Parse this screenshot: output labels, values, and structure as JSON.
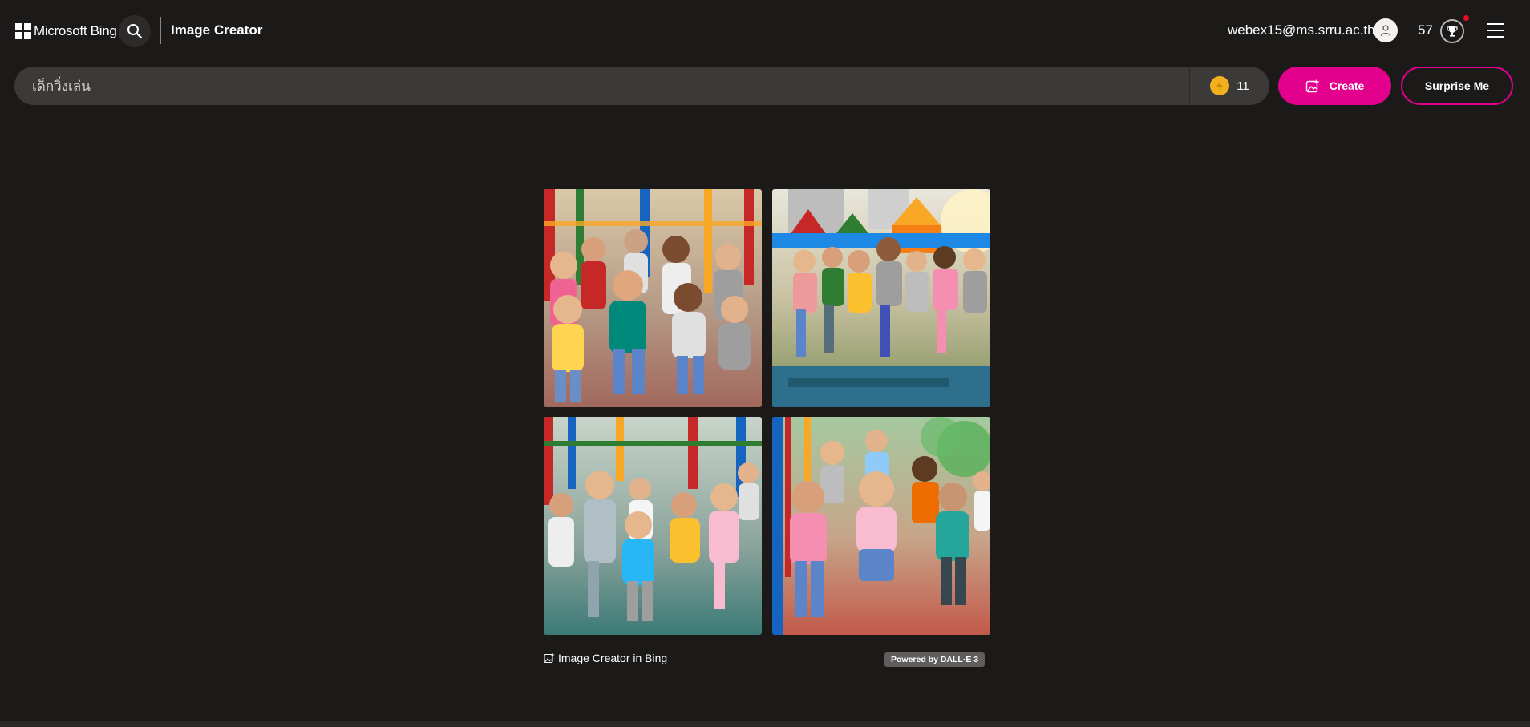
{
  "header": {
    "brand": "Microsoft Bing",
    "title": "Image Creator",
    "user_email": "webex15@ms.srru.ac.th",
    "rewards_points": "57",
    "icons": [
      "microsoft-logo",
      "search-icon",
      "user-avatar-icon",
      "rewards-trophy-icon",
      "hamburger-menu-icon"
    ]
  },
  "prompt": {
    "value": "เด็กวิ่งเล่น",
    "boosts": "11"
  },
  "actions": {
    "create_label": "Create",
    "surprise_label": "Surprise Me"
  },
  "results": {
    "images": [
      {
        "name": "generated-image-1"
      },
      {
        "name": "generated-image-2"
      },
      {
        "name": "generated-image-3"
      },
      {
        "name": "generated-image-4"
      }
    ],
    "footer_label": "Image Creator in Bing",
    "powered_by": "Powered by DALL·E 3"
  },
  "colors": {
    "background": "#1b1a19",
    "prompt_bar": "#3b3a39",
    "accent": "#e3008c",
    "coin": "#f2b01e",
    "notification": "#e81123"
  }
}
